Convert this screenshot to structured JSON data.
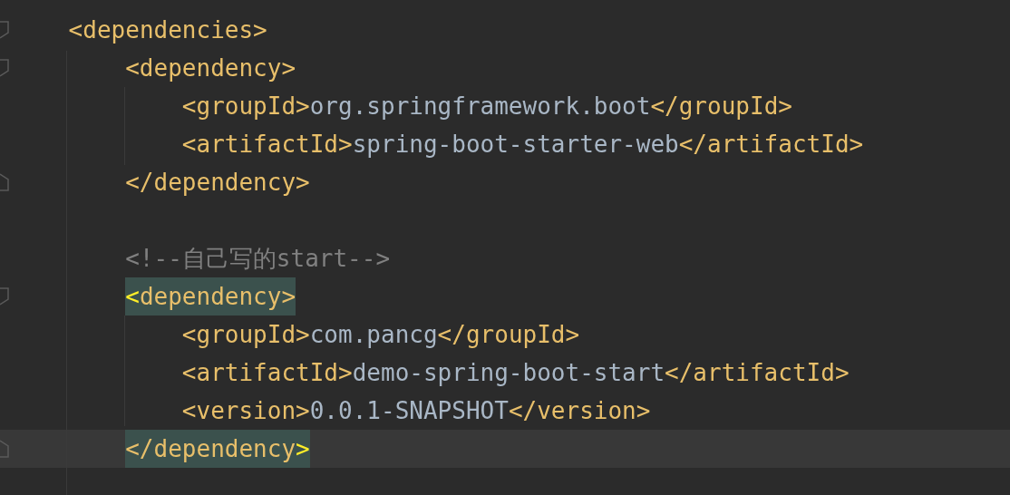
{
  "editor": {
    "lines": [
      {
        "kind": "fold-start",
        "tokens": [
          {
            "kind": "tag",
            "text": "<dependencies>"
          }
        ],
        "children": [
          {
            "kind": "fold-start",
            "tokens": [
              {
                "kind": "tag",
                "text": "<dependency>"
              }
            ],
            "children": [
              {
                "kind": "plain",
                "tokens": [
                  {
                    "kind": "tag",
                    "text": "<groupId>"
                  },
                  {
                    "kind": "value",
                    "text": "org.springframework.boot"
                  },
                  {
                    "kind": "tag",
                    "text": "</groupId>"
                  }
                ]
              },
              {
                "kind": "plain",
                "tokens": [
                  {
                    "kind": "tag",
                    "text": "<artifactId>"
                  },
                  {
                    "kind": "value",
                    "text": "spring-boot-starter-web"
                  },
                  {
                    "kind": "tag",
                    "text": "</artifactId>"
                  }
                ]
              }
            ]
          },
          {
            "kind": "fold-end",
            "tokens": [
              {
                "kind": "tag",
                "text": "</dependency>"
              }
            ]
          },
          {
            "kind": "blank"
          },
          {
            "kind": "plain",
            "tokens": [
              {
                "kind": "comment",
                "text": "<!--自己写的start-->"
              }
            ]
          },
          {
            "kind": "fold-start",
            "tokens": [
              {
                "kind": "bracket",
                "text": "<"
              },
              {
                "kind": "matched",
                "text": "dependency>"
              }
            ],
            "children": [
              {
                "kind": "plain",
                "tokens": [
                  {
                    "kind": "tag",
                    "text": "<groupId>"
                  },
                  {
                    "kind": "value",
                    "text": "com.pancg"
                  },
                  {
                    "kind": "tag",
                    "text": "</groupId>"
                  }
                ]
              },
              {
                "kind": "plain",
                "tokens": [
                  {
                    "kind": "tag",
                    "text": "<artifactId>"
                  },
                  {
                    "kind": "value",
                    "text": "demo-spring-boot-start"
                  },
                  {
                    "kind": "tag",
                    "text": "</artifactId>"
                  }
                ]
              },
              {
                "kind": "plain",
                "tokens": [
                  {
                    "kind": "tag",
                    "text": "<version>"
                  },
                  {
                    "kind": "value",
                    "text": "0.0.1-SNAPSHOT"
                  },
                  {
                    "kind": "tag",
                    "text": "</version>"
                  }
                ]
              }
            ]
          },
          {
            "kind": "fold-end",
            "current": true,
            "tokens": [
              {
                "kind": "matched",
                "text": "</dependency"
              },
              {
                "kind": "bracket",
                "text": ">"
              }
            ]
          },
          {
            "kind": "blank"
          }
        ]
      }
    ]
  }
}
